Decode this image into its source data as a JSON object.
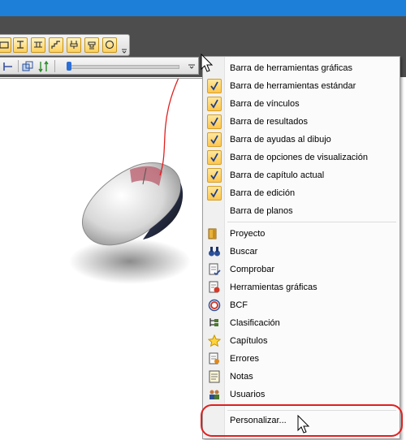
{
  "menu": {
    "checked_items": [
      {
        "label": "Barra de herramientas gráficas",
        "checked": false
      },
      {
        "label": "Barra de herramientas estándar",
        "checked": true
      },
      {
        "label": "Barra de vínculos",
        "checked": true
      },
      {
        "label": "Barra de resultados",
        "checked": true
      },
      {
        "label": "Barra de ayudas al dibujo",
        "checked": true
      },
      {
        "label": "Barra de opciones de visualización",
        "checked": true
      },
      {
        "label": "Barra de capítulo actual",
        "checked": true
      },
      {
        "label": "Barra de edición",
        "checked": true
      },
      {
        "label": "Barra de planos",
        "checked": false
      }
    ],
    "panel_items": [
      {
        "label": "Proyecto",
        "icon": "folder-icon"
      },
      {
        "label": "Buscar",
        "icon": "binoculars-icon"
      },
      {
        "label": "Comprobar",
        "icon": "check-document-icon"
      },
      {
        "label": "Herramientas gráficas",
        "icon": "graphic-tools-icon"
      },
      {
        "label": "BCF",
        "icon": "bcf-icon"
      },
      {
        "label": "Clasificación",
        "icon": "classification-icon"
      },
      {
        "label": "Capítulos",
        "icon": "star-icon"
      },
      {
        "label": "Errores",
        "icon": "errors-icon"
      },
      {
        "label": "Notas",
        "icon": "notes-icon"
      },
      {
        "label": "Usuarios",
        "icon": "users-icon"
      }
    ],
    "customize_label": "Personalizar..."
  },
  "colors": {
    "title_bar": "#1e7fd8",
    "workspace": "#4d4d4d",
    "highlight": "#e02020",
    "check_bg": "#ffc64c"
  }
}
